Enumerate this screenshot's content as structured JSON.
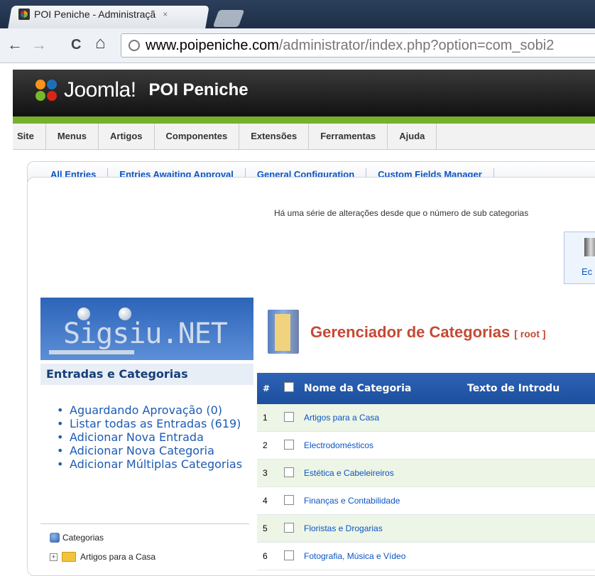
{
  "browser": {
    "tab_title": "POI Peniche - Administraçã",
    "tab_close": "×",
    "url_host": "www.poipeniche.com",
    "url_path": "/administrator/index.php?option=com_sobi2",
    "back": "←",
    "forward": "→",
    "reload": "C",
    "home": "⌂"
  },
  "header": {
    "logo_text": "Joomla!",
    "site_name": "POI Peniche"
  },
  "menu": [
    "Site",
    "Menus",
    "Artigos",
    "Componentes",
    "Extensões",
    "Ferramentas",
    "Ajuda"
  ],
  "submenu": [
    "All Entries",
    "Entries Awaiting Approval",
    "General Configuration",
    "Custom Fields Manager"
  ],
  "notice": "Há uma série de alterações desde que o número de sub categorias",
  "edit_label": "Ec",
  "sidebar": {
    "brand": "Sigsiu.NET",
    "title": "Entradas e Categorias",
    "items": [
      "Aguardando Aprovação (0)",
      "Listar todas as Entradas (619)",
      "Adicionar Nova Entrada",
      "Adicionar Nova Categoria",
      "Adicionar Múltiplas Categorias"
    ],
    "tree_root": "Categorias",
    "tree_first": "Artigos para a Casa"
  },
  "manager": {
    "title": "Gerenciador de Categorias",
    "root": "[ root ]",
    "columns": {
      "num": "#",
      "name": "Nome da Categoria",
      "text": "Texto de Introdu"
    },
    "rows": [
      {
        "n": "1",
        "name": "Artigos para a Casa"
      },
      {
        "n": "2",
        "name": "Electrodomésticos"
      },
      {
        "n": "3",
        "name": "Estética e Cabeleireiros"
      },
      {
        "n": "4",
        "name": "Finanças e Contabilidade"
      },
      {
        "n": "5",
        "name": "Floristas e Drogarias"
      },
      {
        "n": "6",
        "name": "Fotografia, Música e Vídeo"
      }
    ]
  }
}
